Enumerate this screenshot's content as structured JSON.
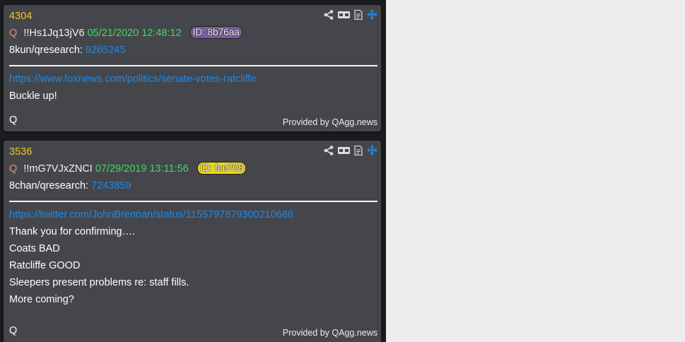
{
  "posts": [
    {
      "number": "4304",
      "author": "Q",
      "tripcode": "!!Hs1Jq13jV6",
      "datetime": "05/21/2020 12:48:12",
      "id_badge": "ID: 8b76aa",
      "id_color": "#7b5fa0",
      "board_label": "8kun/qresearch:",
      "board_post": "9265245",
      "lines": [
        {
          "text": "https://www.foxnews.com/politics/senate-votes-ratcliffe",
          "link": true
        },
        {
          "text": "Buckle up!",
          "link": false
        }
      ],
      "signature": "Q",
      "provider": "Provided by QAgg.news"
    },
    {
      "number": "3536",
      "author": "Q",
      "tripcode": "!!mG7VJxZNCI",
      "datetime": "07/29/2019 13:11:56",
      "id_badge": "ID: fce708",
      "id_color": "#f2da12",
      "board_label": "8chan/qresearch:",
      "board_post": "7243859",
      "lines": [
        {
          "text": "https://twitter.com/JohnBrennan/status/1155797879300210688",
          "link": true
        },
        {
          "text": "Thank you for confirming….",
          "link": false
        },
        {
          "text": "Coats BAD",
          "link": false
        },
        {
          "text": "Ratcliffe GOOD",
          "link": false
        },
        {
          "text": "Sleepers present problems re: staff fills.",
          "link": false
        },
        {
          "text": "More coming?",
          "link": false
        }
      ],
      "signature": "Q",
      "provider": "Provided by QAgg.news"
    }
  ],
  "icons": [
    "share-icon",
    "glasses-icon",
    "document-icon",
    "move-icon"
  ],
  "colors": {
    "post_number": "#f5c518",
    "date": "#45d85f",
    "link": "#1e88e5",
    "q_mark": "#e8926a",
    "card_bg": "#44464c",
    "move_icon": "#1e88e5"
  }
}
